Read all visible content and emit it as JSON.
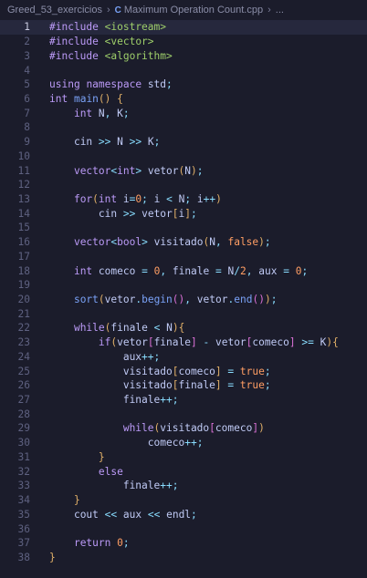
{
  "breadcrumb": {
    "folder": "Greed_53_exercicios",
    "file_icon": "C",
    "file": "Maximum Operation Count.cpp",
    "more": "..."
  },
  "editor": {
    "active_line": 1,
    "lines": [
      {
        "n": "1",
        "text": "#include <iostream>"
      },
      {
        "n": "2",
        "text": "#include <vector>"
      },
      {
        "n": "3",
        "text": "#include <algorithm>"
      },
      {
        "n": "4",
        "text": ""
      },
      {
        "n": "5",
        "text": "using namespace std;"
      },
      {
        "n": "6",
        "text": "int main() {"
      },
      {
        "n": "7",
        "text": "    int N, K;"
      },
      {
        "n": "8",
        "text": ""
      },
      {
        "n": "9",
        "text": "    cin >> N >> K;"
      },
      {
        "n": "10",
        "text": ""
      },
      {
        "n": "11",
        "text": "    vector<int> vetor(N);"
      },
      {
        "n": "12",
        "text": ""
      },
      {
        "n": "13",
        "text": "    for(int i=0; i < N; i++)"
      },
      {
        "n": "14",
        "text": "        cin >> vetor[i];"
      },
      {
        "n": "15",
        "text": ""
      },
      {
        "n": "16",
        "text": "    vector<bool> visitado(N, false);"
      },
      {
        "n": "17",
        "text": ""
      },
      {
        "n": "18",
        "text": "    int comeco = 0, finale = N/2, aux = 0;"
      },
      {
        "n": "19",
        "text": ""
      },
      {
        "n": "20",
        "text": "    sort(vetor.begin(), vetor.end());"
      },
      {
        "n": "21",
        "text": ""
      },
      {
        "n": "22",
        "text": "    while(finale < N){"
      },
      {
        "n": "23",
        "text": "        if(vetor[finale] - vetor[comeco] >= K){"
      },
      {
        "n": "24",
        "text": "            aux++;"
      },
      {
        "n": "25",
        "text": "            visitado[comeco] = true;"
      },
      {
        "n": "26",
        "text": "            visitado[finale] = true;"
      },
      {
        "n": "27",
        "text": "            finale++;"
      },
      {
        "n": "28",
        "text": ""
      },
      {
        "n": "29",
        "text": "            while(visitado[comeco])"
      },
      {
        "n": "30",
        "text": "                comeco++;"
      },
      {
        "n": "31",
        "text": "        }"
      },
      {
        "n": "32",
        "text": "        else"
      },
      {
        "n": "33",
        "text": "            finale++;"
      },
      {
        "n": "34",
        "text": "    }"
      },
      {
        "n": "35",
        "text": "    cout << aux << endl;"
      },
      {
        "n": "36",
        "text": ""
      },
      {
        "n": "37",
        "text": "    return 0;"
      },
      {
        "n": "38",
        "text": "}"
      }
    ]
  },
  "colors": {
    "background": "#1b1c2b",
    "keyword": "#bb9af7",
    "type": "#e0af68",
    "function": "#7aa2f7",
    "number": "#ff9e64",
    "operator": "#89ddff"
  }
}
